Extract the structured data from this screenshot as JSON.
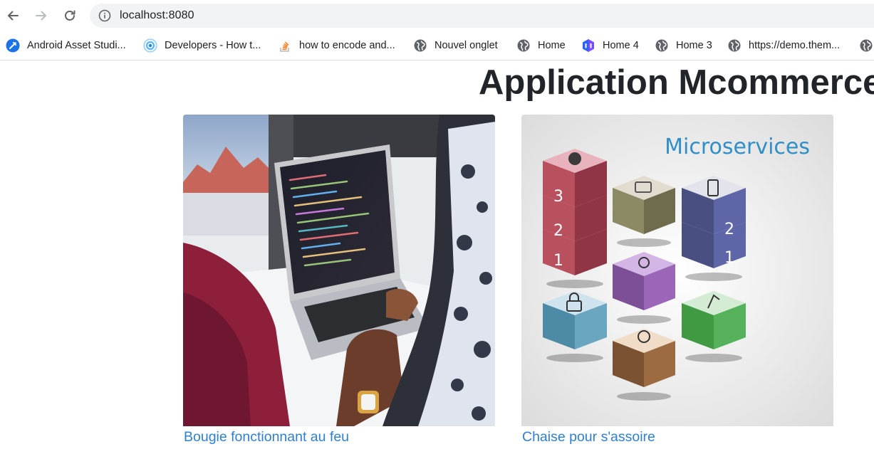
{
  "browser": {
    "url": "localhost:8080",
    "bookmarks": [
      {
        "label": "Android Asset Studi...",
        "icon": "android-asset-studio-icon"
      },
      {
        "label": "Developers - How t...",
        "icon": "developers-site-icon"
      },
      {
        "label": "how to encode and...",
        "icon": "stackoverflow-icon"
      },
      {
        "label": "Nouvel onglet",
        "icon": "globe-icon"
      },
      {
        "label": "Home",
        "icon": "globe-icon"
      },
      {
        "label": "Home 4",
        "icon": "hexagon-logo-icon"
      },
      {
        "label": "Home 3",
        "icon": "globe-icon"
      },
      {
        "label": "https://demo.them...",
        "icon": "globe-icon"
      }
    ]
  },
  "page": {
    "title": "Application Mcommerce",
    "products": [
      {
        "name": "Bougie fonctionnant au feu",
        "image": "laptop-coding-photo"
      },
      {
        "name": "Chaise pour s'assoire",
        "image": "microservices-illustration",
        "image_text": "Microservices",
        "cube_numbers": [
          "3",
          "2",
          "1",
          "2",
          "1"
        ]
      }
    ]
  },
  "colors": {
    "link": "#2f7fd0",
    "title": "#212529",
    "omnibox_bg": "#f1f3f4"
  }
}
